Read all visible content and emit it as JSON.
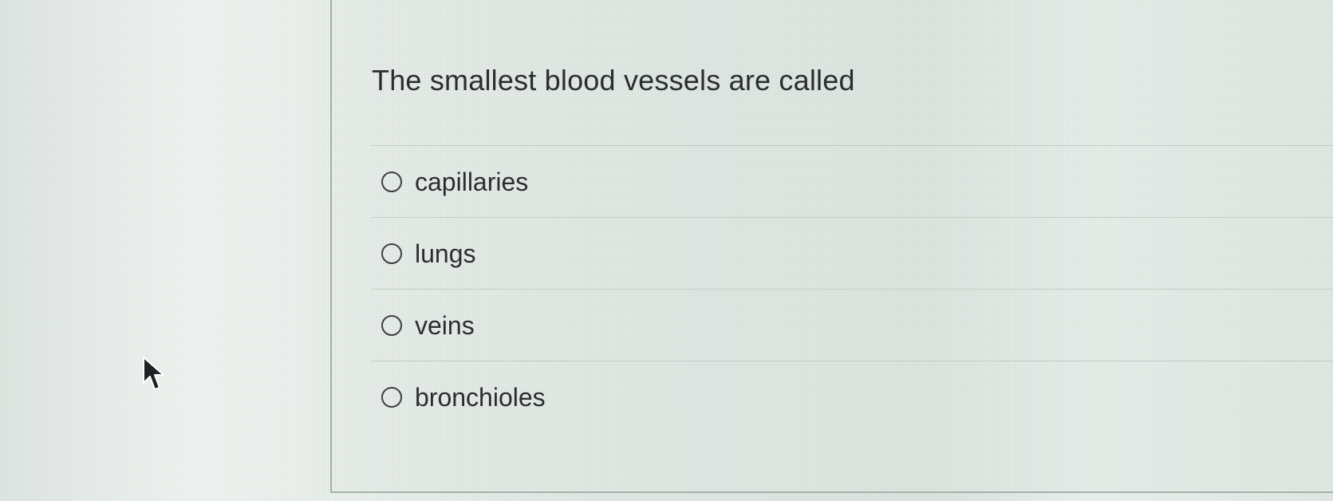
{
  "question": {
    "text": "The smallest blood vessels are called"
  },
  "options": [
    {
      "label": "capillaries",
      "selected": false
    },
    {
      "label": "lungs",
      "selected": false
    },
    {
      "label": "veins",
      "selected": false
    },
    {
      "label": "bronchioles",
      "selected": false
    }
  ],
  "cursor": {
    "icon": "arrow-pointer-icon"
  },
  "colors": {
    "text": "#2b2e2f",
    "radio_border": "#3c4043",
    "divider": "#c1cbc4"
  }
}
